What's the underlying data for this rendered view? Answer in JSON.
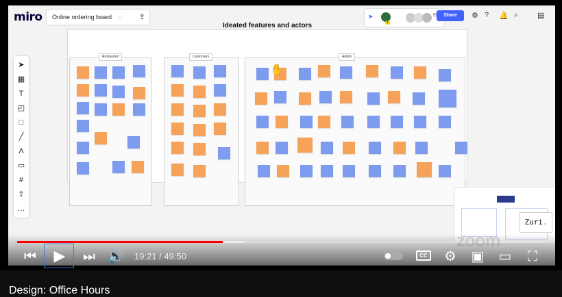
{
  "board": {
    "logo": "miro",
    "name": "Online ordering board",
    "star_icon": "star-icon",
    "export_icon": "upload-icon",
    "collaborator_count": "55",
    "collaborator_badge": "1",
    "share_label": "Share",
    "frame_title": "Ideated features and actors",
    "sections": [
      "Restaurant",
      "Customers",
      "Admin"
    ],
    "tools": [
      "cursor-icon",
      "template-icon",
      "text-icon",
      "sticky-note-icon",
      "shape-icon",
      "pen-icon",
      "line-icon",
      "comment-icon",
      "frame-icon",
      "upload-icon",
      "more-icon"
    ]
  },
  "watermark": {
    "brand": "Zuri",
    "dot": ".",
    "zoom": "zoom"
  },
  "player": {
    "current_time": "19:21",
    "duration": "49:50",
    "time_sep": " / ",
    "played_fraction": 0.3893,
    "loaded_fraction": 0.43,
    "cc_label": "CC",
    "accent": "#ff0000"
  },
  "video_title": "Design: Office Hours"
}
